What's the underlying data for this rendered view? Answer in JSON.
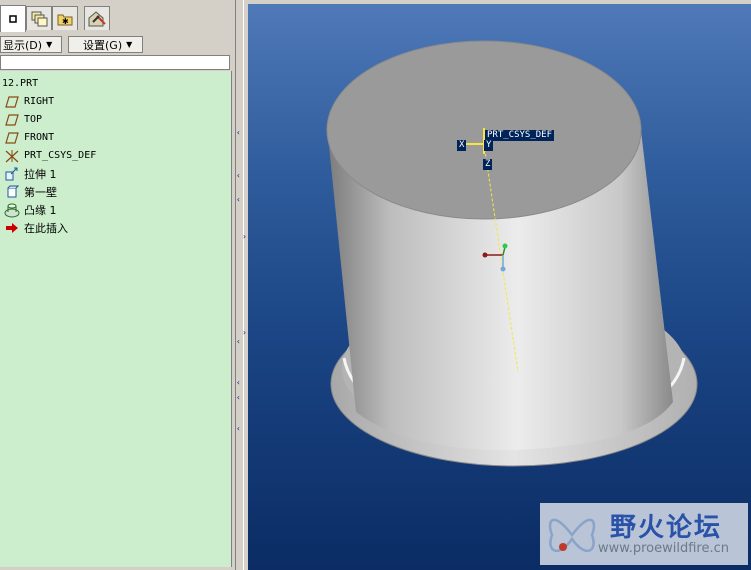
{
  "navigator": {
    "tabs": [
      {
        "icon": "model-tree-icon",
        "active": true
      },
      {
        "icon": "layers-icon",
        "active": false
      },
      {
        "icon": "folder-browser-icon",
        "active": false
      },
      {
        "icon": "favorites-icon",
        "active": false
      }
    ],
    "menus": {
      "display_label": "显示(D)",
      "settings_label": "设置(G)"
    },
    "filter_value": "",
    "tree": {
      "root_label": "12.PRT",
      "items": [
        {
          "label": "RIGHT",
          "icon": "datum-plane-icon"
        },
        {
          "label": "TOP",
          "icon": "datum-plane-icon"
        },
        {
          "label": "FRONT",
          "icon": "datum-plane-icon"
        },
        {
          "label": "PRT_CSYS_DEF",
          "icon": "coordinate-system-icon"
        },
        {
          "label": "拉伸 1",
          "icon": "extrude-icon"
        },
        {
          "label": "第一壁",
          "icon": "first-wall-icon"
        },
        {
          "label": "凸缘 1",
          "icon": "flange-icon"
        },
        {
          "label": "在此插入",
          "icon": "insert-here-arrow-icon"
        }
      ]
    }
  },
  "viewport": {
    "csys_label": "PRT_CSYS_DEF",
    "axis_x": "X",
    "axis_y": "Y",
    "axis_z": "Z",
    "background_top": "#4f79b8",
    "background_bottom": "#0b2c64"
  },
  "watermark": {
    "title": "野火论坛",
    "url": "www.proewildfire.cn"
  },
  "colors": {
    "tree_background": "#cceecc",
    "chrome": "#d4d0c8",
    "insert_arrow": "#cc0000"
  }
}
